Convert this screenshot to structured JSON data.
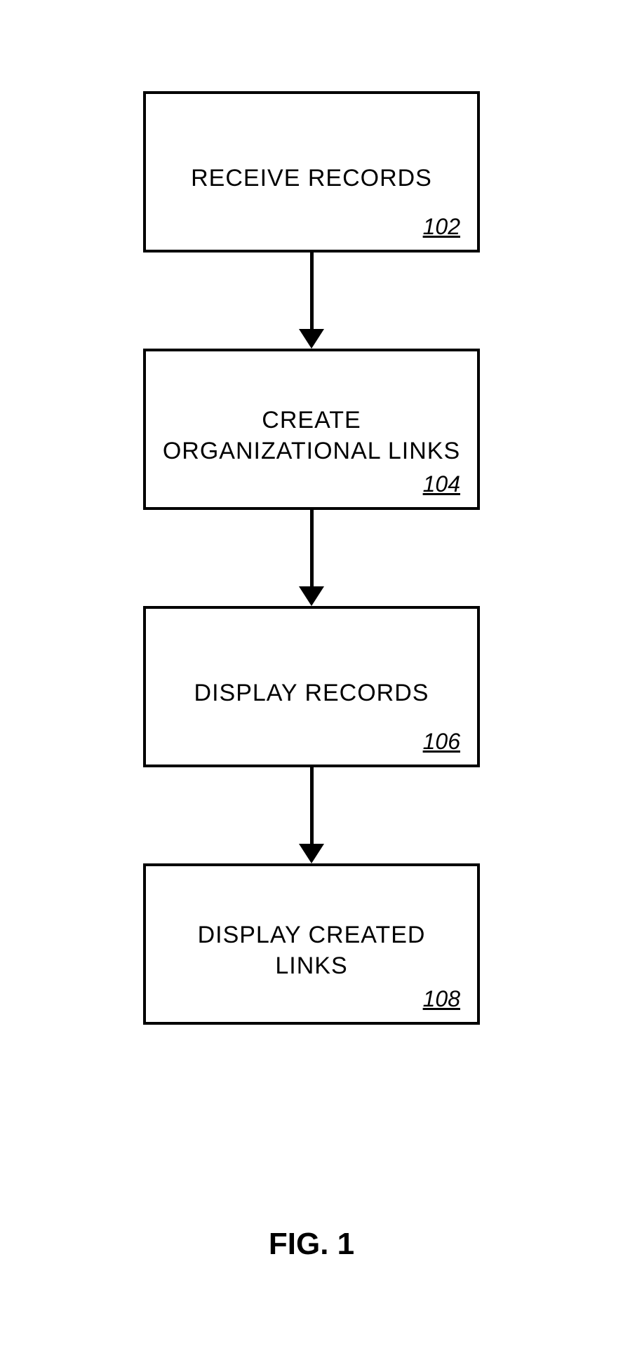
{
  "chart_data": {
    "type": "flowchart",
    "direction": "top-to-bottom",
    "nodes": [
      {
        "id": "102",
        "label": "RECEIVE RECORDS",
        "ref": "102"
      },
      {
        "id": "104",
        "label": "CREATE ORGANIZATIONAL LINKS",
        "ref": "104"
      },
      {
        "id": "106",
        "label": "DISPLAY RECORDS",
        "ref": "106"
      },
      {
        "id": "108",
        "label": "DISPLAY CREATED LINKS",
        "ref": "108"
      }
    ],
    "edges": [
      {
        "from": "102",
        "to": "104"
      },
      {
        "from": "104",
        "to": "106"
      },
      {
        "from": "106",
        "to": "108"
      }
    ],
    "caption": "FIG. 1"
  },
  "steps": [
    {
      "label": "RECEIVE RECORDS",
      "ref": "102"
    },
    {
      "label": "CREATE\nORGANIZATIONAL LINKS",
      "ref": "104"
    },
    {
      "label": "DISPLAY RECORDS",
      "ref": "106"
    },
    {
      "label": "DISPLAY CREATED LINKS",
      "ref": "108"
    }
  ],
  "caption": "FIG. 1"
}
